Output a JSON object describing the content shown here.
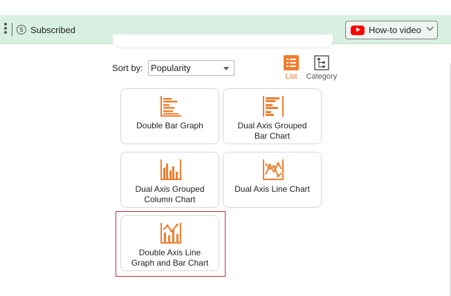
{
  "header": {
    "subscribed_label": "Subscribed",
    "howto_label": "How-to video"
  },
  "sort": {
    "label": "Sort by:",
    "selected": "Popularity"
  },
  "view_toggle": {
    "list_label": "List",
    "category_label": "Category",
    "active": "List"
  },
  "charts": [
    {
      "label_line1": "Double Bar Graph",
      "label_line2": "",
      "icon": "double-bar-graph-icon"
    },
    {
      "label_line1": "Dual Axis Grouped",
      "label_line2": "Bar Chart",
      "icon": "dual-axis-grouped-bar-icon"
    },
    {
      "label_line1": "Dual Axis Grouped",
      "label_line2": "Column Chart",
      "icon": "dual-axis-grouped-column-icon"
    },
    {
      "label_line1": "Dual Axis Line Chart",
      "label_line2": "",
      "icon": "dual-axis-line-chart-icon"
    },
    {
      "label_line1": "Double Axis Line",
      "label_line2": "Graph and Bar Chart",
      "icon": "double-axis-line-bar-icon"
    }
  ],
  "colors": {
    "accent": "#f07d2e",
    "topbar": "#d8f0e1",
    "highlight": "#d0262a"
  }
}
